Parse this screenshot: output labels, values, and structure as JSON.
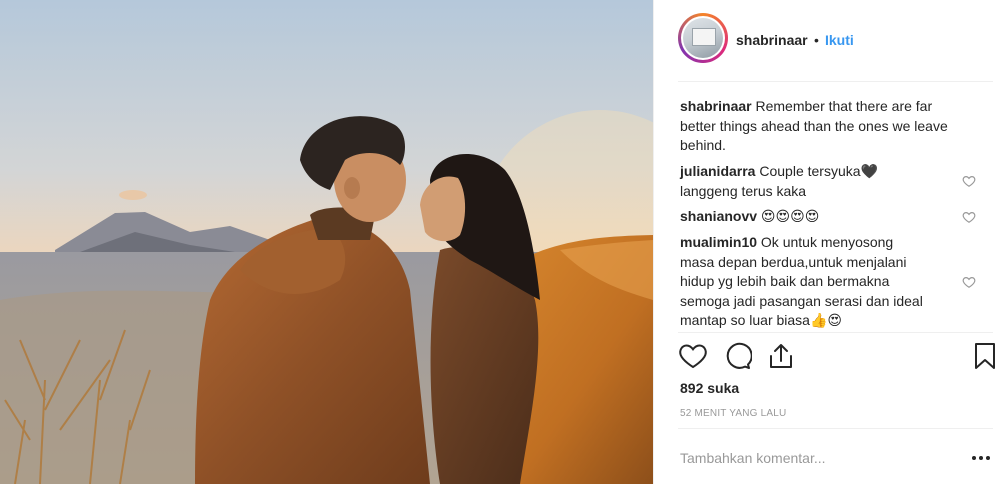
{
  "post": {
    "author": "shabrinaar",
    "separator": "•",
    "follow_label": "Ikuti",
    "likes": "892 suka",
    "timestamp": "52 MENIT YANG LALU",
    "comment_placeholder": "Tambahkan komentar..."
  },
  "caption": {
    "user": "shabrinaar",
    "line1": "Remember that there are far",
    "line2": "better things ahead than the ones we leave",
    "line3": "behind."
  },
  "comments": [
    {
      "user": "julianidarra",
      "line1": "Couple tersyuka🖤",
      "line2": "langgeng terus kaka"
    },
    {
      "user": "shanianovv",
      "line1": "😍😍😍😍"
    },
    {
      "user": "mualimin10",
      "line1": "Ok untuk menyosong",
      "line2": "masa depan berdua,untuk menjalani",
      "line3": "hidup yg lebih baik dan bermakna",
      "line4": "semoga jadi pasangan serasi dan ideal",
      "line5": "mantap so luar biasa👍😍"
    }
  ],
  "icons": {
    "like": "heart-icon",
    "comment": "comment-icon",
    "share": "share-icon",
    "save": "bookmark-icon",
    "options": "more-options-icon"
  },
  "colors": {
    "link": "#3897f0",
    "text": "#262626",
    "muted": "#999999"
  }
}
